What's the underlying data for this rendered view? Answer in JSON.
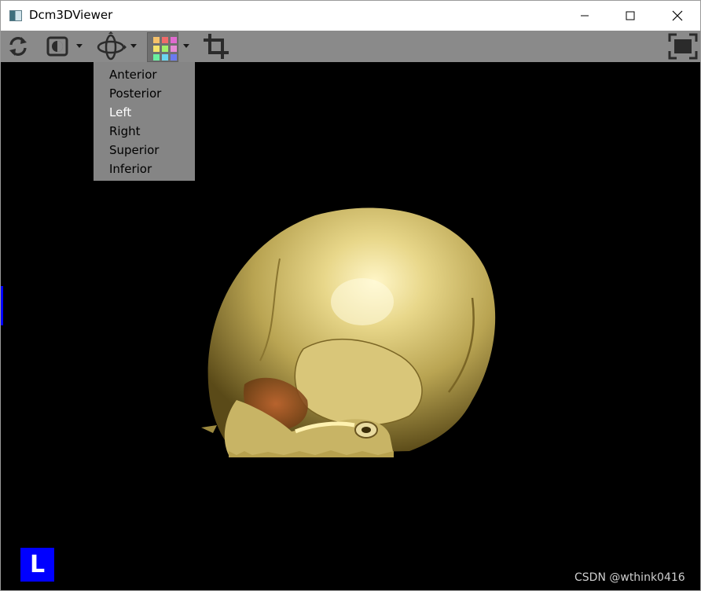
{
  "window": {
    "title": "Dcm3DViewer"
  },
  "toolbar": {
    "tools": [
      {
        "icon": "refresh-icon"
      },
      {
        "icon": "contrast-icon",
        "has_dropdown": true
      },
      {
        "icon": "orientation-gyro-icon",
        "has_dropdown": true
      },
      {
        "icon": "color-palette-icon",
        "has_dropdown": true,
        "active": true
      },
      {
        "icon": "crop-icon"
      },
      {
        "icon": "fullscreen-icon"
      }
    ],
    "palette_colors": [
      "#f5c16a",
      "#f06a6a",
      "#e06ad0",
      "#f5e36a",
      "#a0f06a",
      "#e68ad6",
      "#6af0a0",
      "#6ad6f0",
      "#6a7af0"
    ]
  },
  "orientation_menu": {
    "items": [
      {
        "label": "Anterior"
      },
      {
        "label": "Posterior"
      },
      {
        "label": "Left",
        "highlighted": true
      },
      {
        "label": "Right"
      },
      {
        "label": "Superior"
      },
      {
        "label": "Inferior"
      }
    ]
  },
  "viewport": {
    "orientation_label": "L",
    "watermark": "CSDN @wthink0416"
  },
  "colors": {
    "toolbar_bg": "#8a8a8a",
    "menu_bg": "#858585",
    "viewport_bg": "#000000",
    "orientation_badge": "#0000ff",
    "bone": "#d8c97a"
  }
}
